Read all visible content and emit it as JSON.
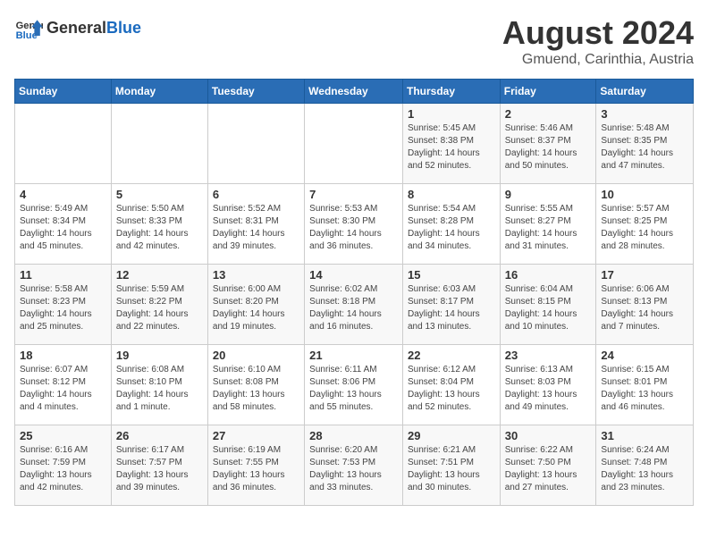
{
  "header": {
    "logo_line1": "General",
    "logo_line2": "Blue",
    "month_year": "August 2024",
    "location": "Gmuend, Carinthia, Austria"
  },
  "weekdays": [
    "Sunday",
    "Monday",
    "Tuesday",
    "Wednesday",
    "Thursday",
    "Friday",
    "Saturday"
  ],
  "weeks": [
    [
      {
        "day": "",
        "info": ""
      },
      {
        "day": "",
        "info": ""
      },
      {
        "day": "",
        "info": ""
      },
      {
        "day": "",
        "info": ""
      },
      {
        "day": "1",
        "info": "Sunrise: 5:45 AM\nSunset: 8:38 PM\nDaylight: 14 hours\nand 52 minutes."
      },
      {
        "day": "2",
        "info": "Sunrise: 5:46 AM\nSunset: 8:37 PM\nDaylight: 14 hours\nand 50 minutes."
      },
      {
        "day": "3",
        "info": "Sunrise: 5:48 AM\nSunset: 8:35 PM\nDaylight: 14 hours\nand 47 minutes."
      }
    ],
    [
      {
        "day": "4",
        "info": "Sunrise: 5:49 AM\nSunset: 8:34 PM\nDaylight: 14 hours\nand 45 minutes."
      },
      {
        "day": "5",
        "info": "Sunrise: 5:50 AM\nSunset: 8:33 PM\nDaylight: 14 hours\nand 42 minutes."
      },
      {
        "day": "6",
        "info": "Sunrise: 5:52 AM\nSunset: 8:31 PM\nDaylight: 14 hours\nand 39 minutes."
      },
      {
        "day": "7",
        "info": "Sunrise: 5:53 AM\nSunset: 8:30 PM\nDaylight: 14 hours\nand 36 minutes."
      },
      {
        "day": "8",
        "info": "Sunrise: 5:54 AM\nSunset: 8:28 PM\nDaylight: 14 hours\nand 34 minutes."
      },
      {
        "day": "9",
        "info": "Sunrise: 5:55 AM\nSunset: 8:27 PM\nDaylight: 14 hours\nand 31 minutes."
      },
      {
        "day": "10",
        "info": "Sunrise: 5:57 AM\nSunset: 8:25 PM\nDaylight: 14 hours\nand 28 minutes."
      }
    ],
    [
      {
        "day": "11",
        "info": "Sunrise: 5:58 AM\nSunset: 8:23 PM\nDaylight: 14 hours\nand 25 minutes."
      },
      {
        "day": "12",
        "info": "Sunrise: 5:59 AM\nSunset: 8:22 PM\nDaylight: 14 hours\nand 22 minutes."
      },
      {
        "day": "13",
        "info": "Sunrise: 6:00 AM\nSunset: 8:20 PM\nDaylight: 14 hours\nand 19 minutes."
      },
      {
        "day": "14",
        "info": "Sunrise: 6:02 AM\nSunset: 8:18 PM\nDaylight: 14 hours\nand 16 minutes."
      },
      {
        "day": "15",
        "info": "Sunrise: 6:03 AM\nSunset: 8:17 PM\nDaylight: 14 hours\nand 13 minutes."
      },
      {
        "day": "16",
        "info": "Sunrise: 6:04 AM\nSunset: 8:15 PM\nDaylight: 14 hours\nand 10 minutes."
      },
      {
        "day": "17",
        "info": "Sunrise: 6:06 AM\nSunset: 8:13 PM\nDaylight: 14 hours\nand 7 minutes."
      }
    ],
    [
      {
        "day": "18",
        "info": "Sunrise: 6:07 AM\nSunset: 8:12 PM\nDaylight: 14 hours\nand 4 minutes."
      },
      {
        "day": "19",
        "info": "Sunrise: 6:08 AM\nSunset: 8:10 PM\nDaylight: 14 hours\nand 1 minute."
      },
      {
        "day": "20",
        "info": "Sunrise: 6:10 AM\nSunset: 8:08 PM\nDaylight: 13 hours\nand 58 minutes."
      },
      {
        "day": "21",
        "info": "Sunrise: 6:11 AM\nSunset: 8:06 PM\nDaylight: 13 hours\nand 55 minutes."
      },
      {
        "day": "22",
        "info": "Sunrise: 6:12 AM\nSunset: 8:04 PM\nDaylight: 13 hours\nand 52 minutes."
      },
      {
        "day": "23",
        "info": "Sunrise: 6:13 AM\nSunset: 8:03 PM\nDaylight: 13 hours\nand 49 minutes."
      },
      {
        "day": "24",
        "info": "Sunrise: 6:15 AM\nSunset: 8:01 PM\nDaylight: 13 hours\nand 46 minutes."
      }
    ],
    [
      {
        "day": "25",
        "info": "Sunrise: 6:16 AM\nSunset: 7:59 PM\nDaylight: 13 hours\nand 42 minutes."
      },
      {
        "day": "26",
        "info": "Sunrise: 6:17 AM\nSunset: 7:57 PM\nDaylight: 13 hours\nand 39 minutes."
      },
      {
        "day": "27",
        "info": "Sunrise: 6:19 AM\nSunset: 7:55 PM\nDaylight: 13 hours\nand 36 minutes."
      },
      {
        "day": "28",
        "info": "Sunrise: 6:20 AM\nSunset: 7:53 PM\nDaylight: 13 hours\nand 33 minutes."
      },
      {
        "day": "29",
        "info": "Sunrise: 6:21 AM\nSunset: 7:51 PM\nDaylight: 13 hours\nand 30 minutes."
      },
      {
        "day": "30",
        "info": "Sunrise: 6:22 AM\nSunset: 7:50 PM\nDaylight: 13 hours\nand 27 minutes."
      },
      {
        "day": "31",
        "info": "Sunrise: 6:24 AM\nSunset: 7:48 PM\nDaylight: 13 hours\nand 23 minutes."
      }
    ]
  ]
}
